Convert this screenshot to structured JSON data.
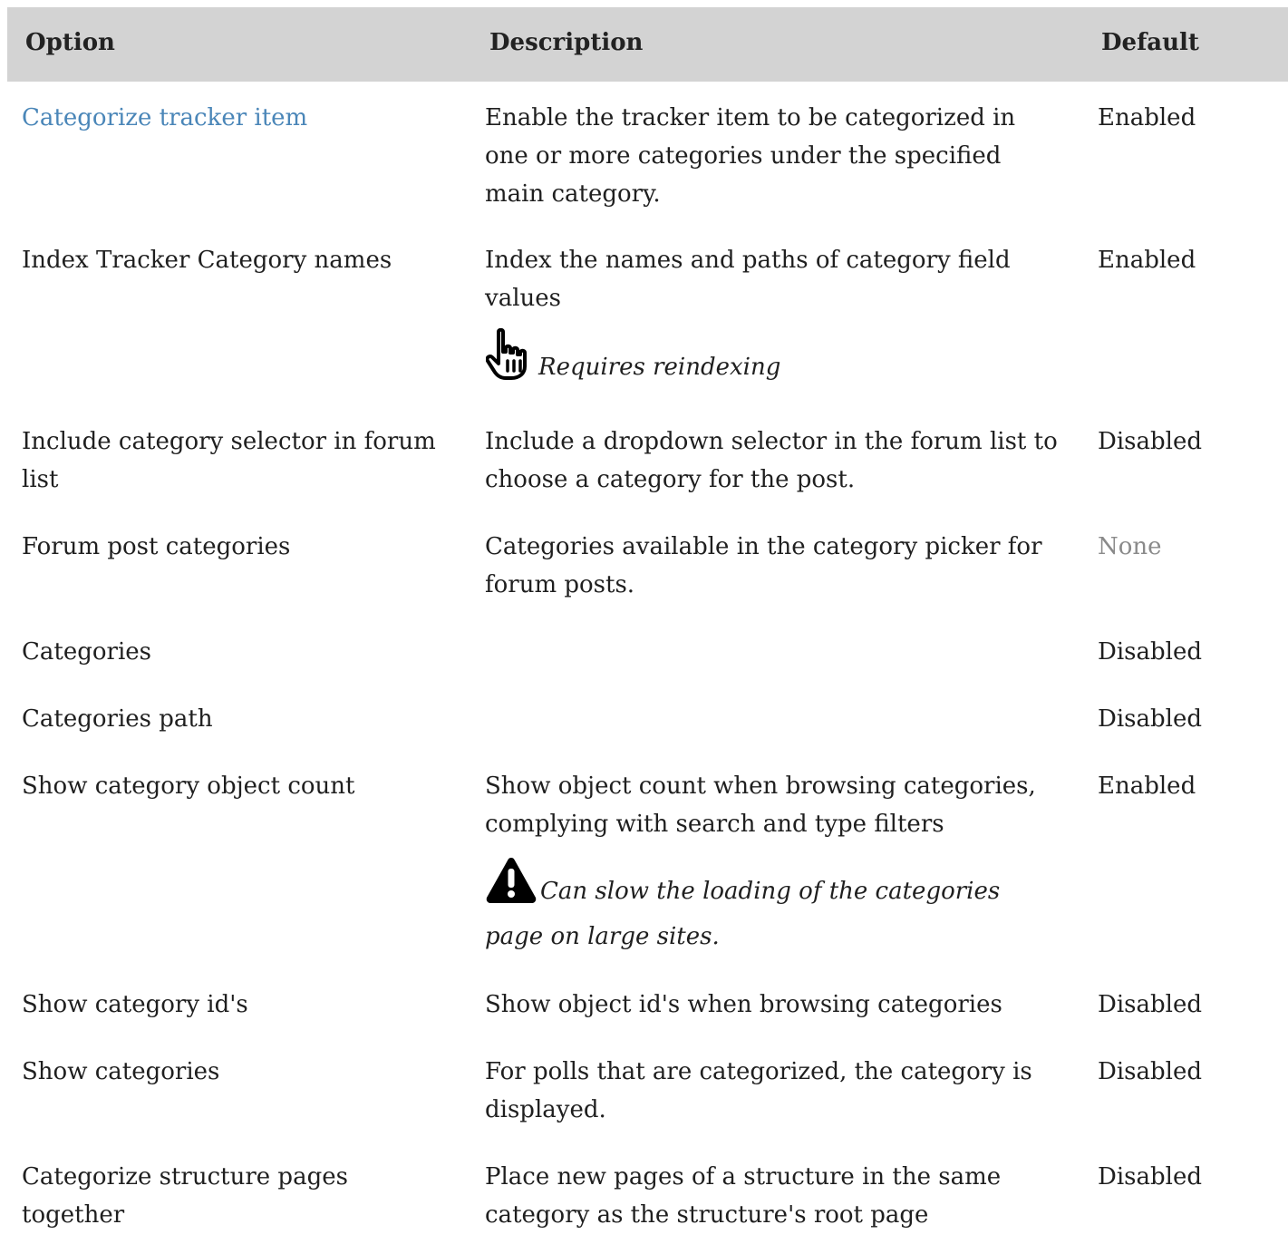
{
  "header": {
    "option": "Option",
    "description": "Description",
    "default": "Default"
  },
  "rows": [
    {
      "option": "Categorize tracker item",
      "option_is_link": true,
      "description": [
        "Enable the tracker item to be categorized in",
        "one or more categories under the specified",
        "main category."
      ],
      "default": "Enabled"
    },
    {
      "option": "Index Tracker Category names",
      "description": [
        "Index the names and paths of category field",
        "values"
      ],
      "note": {
        "icon": "pointing-hand-icon",
        "lines": [
          "Requires reindexing"
        ]
      },
      "default": "Enabled"
    },
    {
      "option_lines": [
        "Include category selector in forum",
        "list"
      ],
      "description": [
        "Include a dropdown selector in the forum list to",
        "choose a category for the post."
      ],
      "default": "Disabled"
    },
    {
      "option": "Forum post categories",
      "description": [
        "Categories available in the category picker for",
        "forum posts."
      ],
      "default": "None",
      "default_muted": true
    },
    {
      "option": "Categories",
      "description": [],
      "default": "Disabled"
    },
    {
      "option": "Categories path",
      "description": [],
      "default": "Disabled"
    },
    {
      "option": "Show category object count",
      "description": [
        "Show object count when browsing categories,",
        "complying with search and type filters"
      ],
      "note": {
        "icon": "warning-icon",
        "lines": [
          "Can slow the loading of the categories",
          "page on large sites."
        ]
      },
      "default": "Enabled"
    },
    {
      "option": "Show category id's",
      "description": [
        "Show object id's when browsing categories"
      ],
      "default": "Disabled"
    },
    {
      "option": "Show categories",
      "description": [
        "For polls that are categorized, the category is",
        "displayed."
      ],
      "default": "Disabled"
    },
    {
      "option_lines": [
        "Categorize structure pages",
        "together"
      ],
      "description": [
        "Place new pages of a structure in the same",
        "category as the structure's root page"
      ],
      "default": "Disabled"
    }
  ]
}
